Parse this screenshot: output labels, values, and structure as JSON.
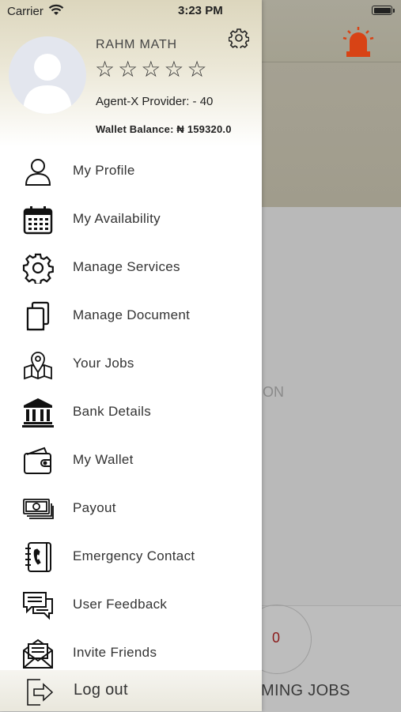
{
  "status_bar": {
    "carrier": "Carrier",
    "time": "3:23 PM"
  },
  "profile": {
    "name": "RAHM MATH",
    "rating_stars": 5,
    "rating_filled": 0,
    "provider_line": "Agent-X Provider: - 40",
    "wallet_line": "Wallet Balance: ₦ 159320.0"
  },
  "menu": {
    "items": [
      {
        "label": "My Profile",
        "icon": "user-icon"
      },
      {
        "label": "My Availability",
        "icon": "calendar-icon"
      },
      {
        "label": "Manage Services",
        "icon": "gear-icon"
      },
      {
        "label": "Manage Document",
        "icon": "documents-icon"
      },
      {
        "label": "Your Jobs",
        "icon": "map-pin-icon"
      },
      {
        "label": "Bank Details",
        "icon": "bank-icon"
      },
      {
        "label": "My Wallet",
        "icon": "wallet-icon"
      },
      {
        "label": "Payout",
        "icon": "cash-icon"
      },
      {
        "label": "Emergency Contact",
        "icon": "phone-book-icon"
      },
      {
        "label": "User Feedback",
        "icon": "chat-icon"
      },
      {
        "label": "Invite Friends",
        "icon": "envelope-icon"
      }
    ],
    "logout_label": "Log out"
  },
  "background": {
    "partial_text": "ON",
    "upcoming_count": "0",
    "upcoming_label": "MING JOBS"
  },
  "colors": {
    "alarm": "#d84315",
    "drawer_header": "#dcd6bd",
    "count_text": "#8b1a1a"
  }
}
